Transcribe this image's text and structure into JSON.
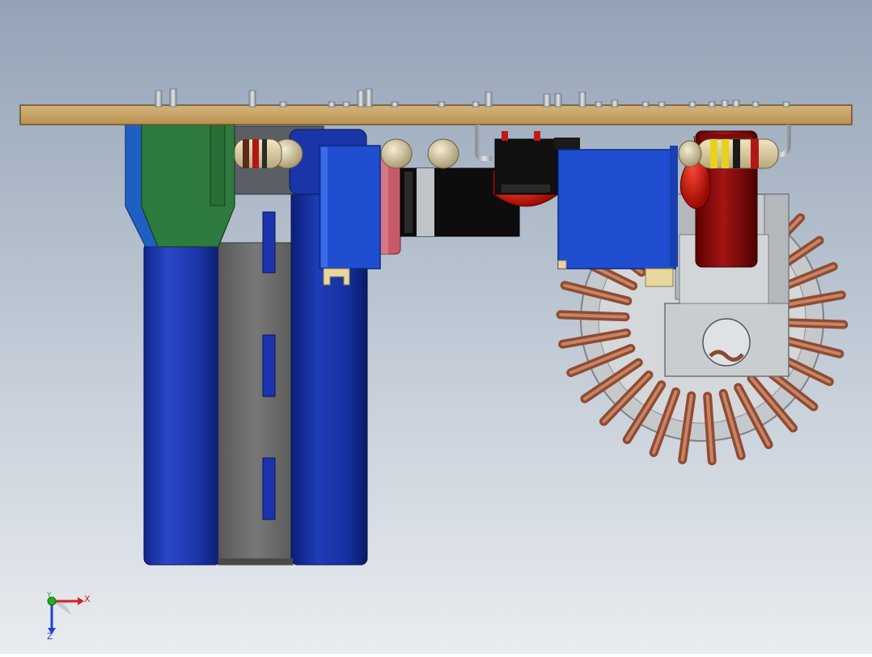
{
  "view": {
    "background_top": "#93a3b6",
    "background_bottom": "#e7ebf0",
    "pcb_color": "#c8a36a",
    "capacitor_blue": "#1a35a8",
    "wire_copper": "#a25a3f"
  },
  "triad": {
    "x_label": "X",
    "y_label": "Y",
    "z_label": "Z",
    "x_color": "#d42020",
    "y_color": "#20b020",
    "z_color": "#2040d0"
  }
}
